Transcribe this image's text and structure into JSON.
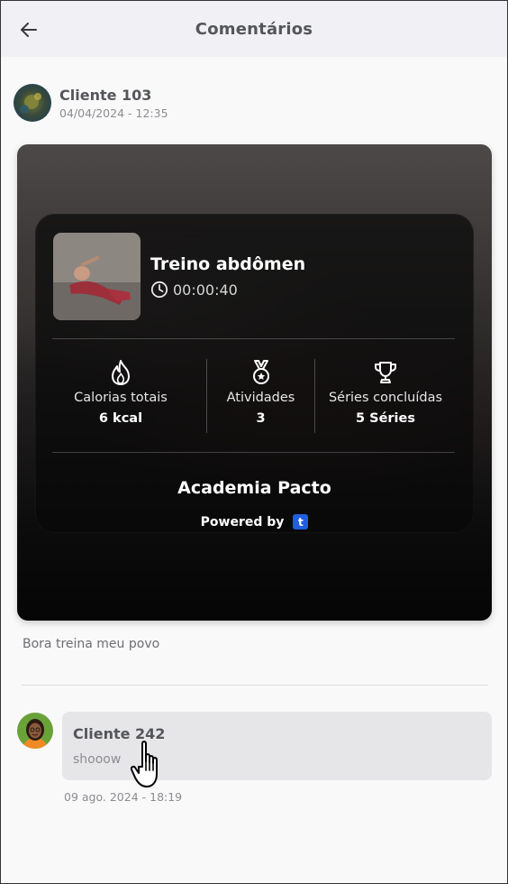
{
  "header": {
    "title": "Comentários",
    "back_icon": "arrow-left-icon"
  },
  "post": {
    "author_name": "Cliente 103",
    "timestamp": "04/04/2024 - 12:35",
    "card": {
      "workout_title": "Treino abdômen",
      "duration": "00:00:40",
      "stats": [
        {
          "icon": "flame-icon",
          "label": "Calorias totais",
          "value": "6 kcal"
        },
        {
          "icon": "medal-icon",
          "label": "Atividades",
          "value": "3"
        },
        {
          "icon": "trophy-icon",
          "label": "Séries concluídas",
          "value": "5 Séries"
        }
      ],
      "gym_name": "Academia Pacto",
      "powered_by": "Powered by",
      "powered_logo": "t"
    },
    "caption": "Bora treina meu povo"
  },
  "comments": [
    {
      "author_name": "Cliente 242",
      "text": "shooow",
      "timestamp": "09 ago. 2024 - 18:19"
    }
  ],
  "colors": {
    "header_bg": "#f1f1f5",
    "bubble_bg": "#e6e6e9",
    "brand_blue": "#1f5fe0"
  }
}
